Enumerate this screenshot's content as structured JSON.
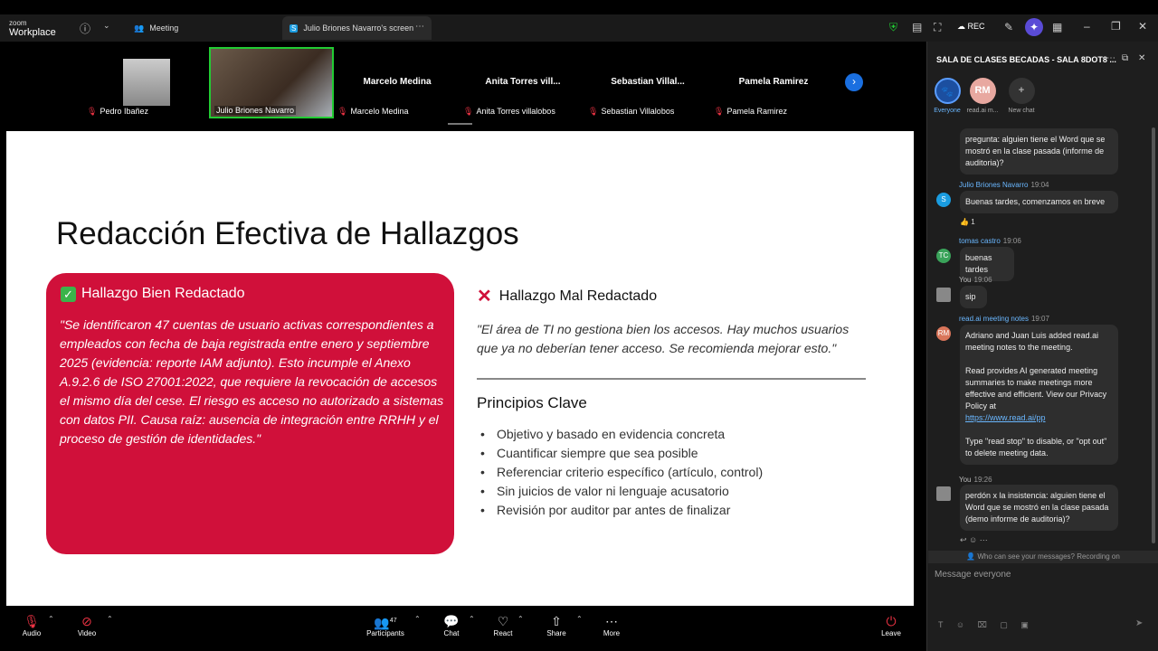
{
  "app": {
    "logo_top": "zoom",
    "logo_bottom": "Workplace",
    "rec": "REC"
  },
  "tabs": {
    "meeting": "Meeting",
    "screen": "Julio Briones Navarro's screen"
  },
  "participants": [
    {
      "name": "Pedro Ibañez"
    },
    {
      "name": "Julio Briones Navarro"
    },
    {
      "name": "Marcelo Medina",
      "big": "Marcelo Medina"
    },
    {
      "name": "Anita Torres villalobos",
      "big": "Anita Torres vill..."
    },
    {
      "name": "Sebastian Villalobos",
      "big": "Sebastian  Villal..."
    },
    {
      "name": "Pamela Ramirez",
      "big": "Pamela Ramirez"
    }
  ],
  "slide": {
    "title": "Redacción Efectiva de Hallazgos",
    "good_heading": "Hallazgo Bien Redactado",
    "good_text": "\"Se identificaron 47 cuentas de usuario activas correspondientes a empleados con fecha de baja registrada entre enero y septiembre 2025 (evidencia: reporte IAM adjunto). Esto incumple el Anexo A.9.2.6 de ISO 27001:2022, que requiere la revocación de accesos el mismo día del cese. El riesgo es acceso no autorizado a sistemas con datos PII. Causa raíz: ausencia de integración entre RRHH y el proceso de gestión de identidades.\"",
    "bad_heading": "Hallazgo Mal Redactado",
    "bad_text": "\"El área de TI no gestiona bien los accesos. Hay muchos usuarios que ya no deberían tener acceso. Se recomienda mejorar esto.\"",
    "principles_heading": "Principios Clave",
    "principles": [
      "Objetivo y basado en evidencia concreta",
      "Cuantificar siempre que sea posible",
      "Referenciar criterio específico (artículo, control)",
      "Sin juicios de valor ni lenguaje acusatorio",
      "Revisión por auditor par antes de finalizar"
    ]
  },
  "toolbar": {
    "audio": "Audio",
    "video": "Video",
    "participants": "Participants",
    "participants_count": "47",
    "chat": "Chat",
    "react": "React",
    "share": "Share",
    "more": "More",
    "leave": "Leave"
  },
  "chat": {
    "title": "SALA DE CLASES BECADAS - SALA 8DOT8 ...",
    "tabs": [
      {
        "label": "Everyone"
      },
      {
        "label": "read.ai m...",
        "initials": "RM"
      },
      {
        "label": "New chat"
      }
    ],
    "msg0": "pregunta: alguien tiene el Word que se mostró en la clase pasada (informe de auditoria)?",
    "m1_who": "Julio Briones Navarro",
    "m1_time": "19:04",
    "m1_text": "Buenas tardes, comenzamos en breve",
    "m1_react": "1",
    "m1_avatar": "S",
    "m2_who": "tomas castro",
    "m2_time": "19:06",
    "m2_text": "buenas tardes",
    "m2_avatar": "TC",
    "m3_who": "You",
    "m3_time": "19:06",
    "m3_text": "sip",
    "m4_who": "read.ai meeting notes",
    "m4_time": "19:07",
    "m4_avatar": "RM",
    "m4_p1": "Adriano and Juan Luis added read.ai meeting notes to the meeting.",
    "m4_p2": "Read provides AI generated meeting summaries to make meetings more effective and efficient. View our Privacy Policy at",
    "m4_link": "https://www.read.ai/pp",
    "m4_p3": "Type \"read stop\" to disable, or \"opt out\" to delete meeting data.",
    "m5_who": "You",
    "m5_time": "19:26",
    "m5_text": "perdón x la insistencia: alguien tiene el Word que se mostró en la clase pasada (demo informe de auditoria)?",
    "notice": "Who can see your messages? Recording on",
    "placeholder": "Message everyone"
  }
}
